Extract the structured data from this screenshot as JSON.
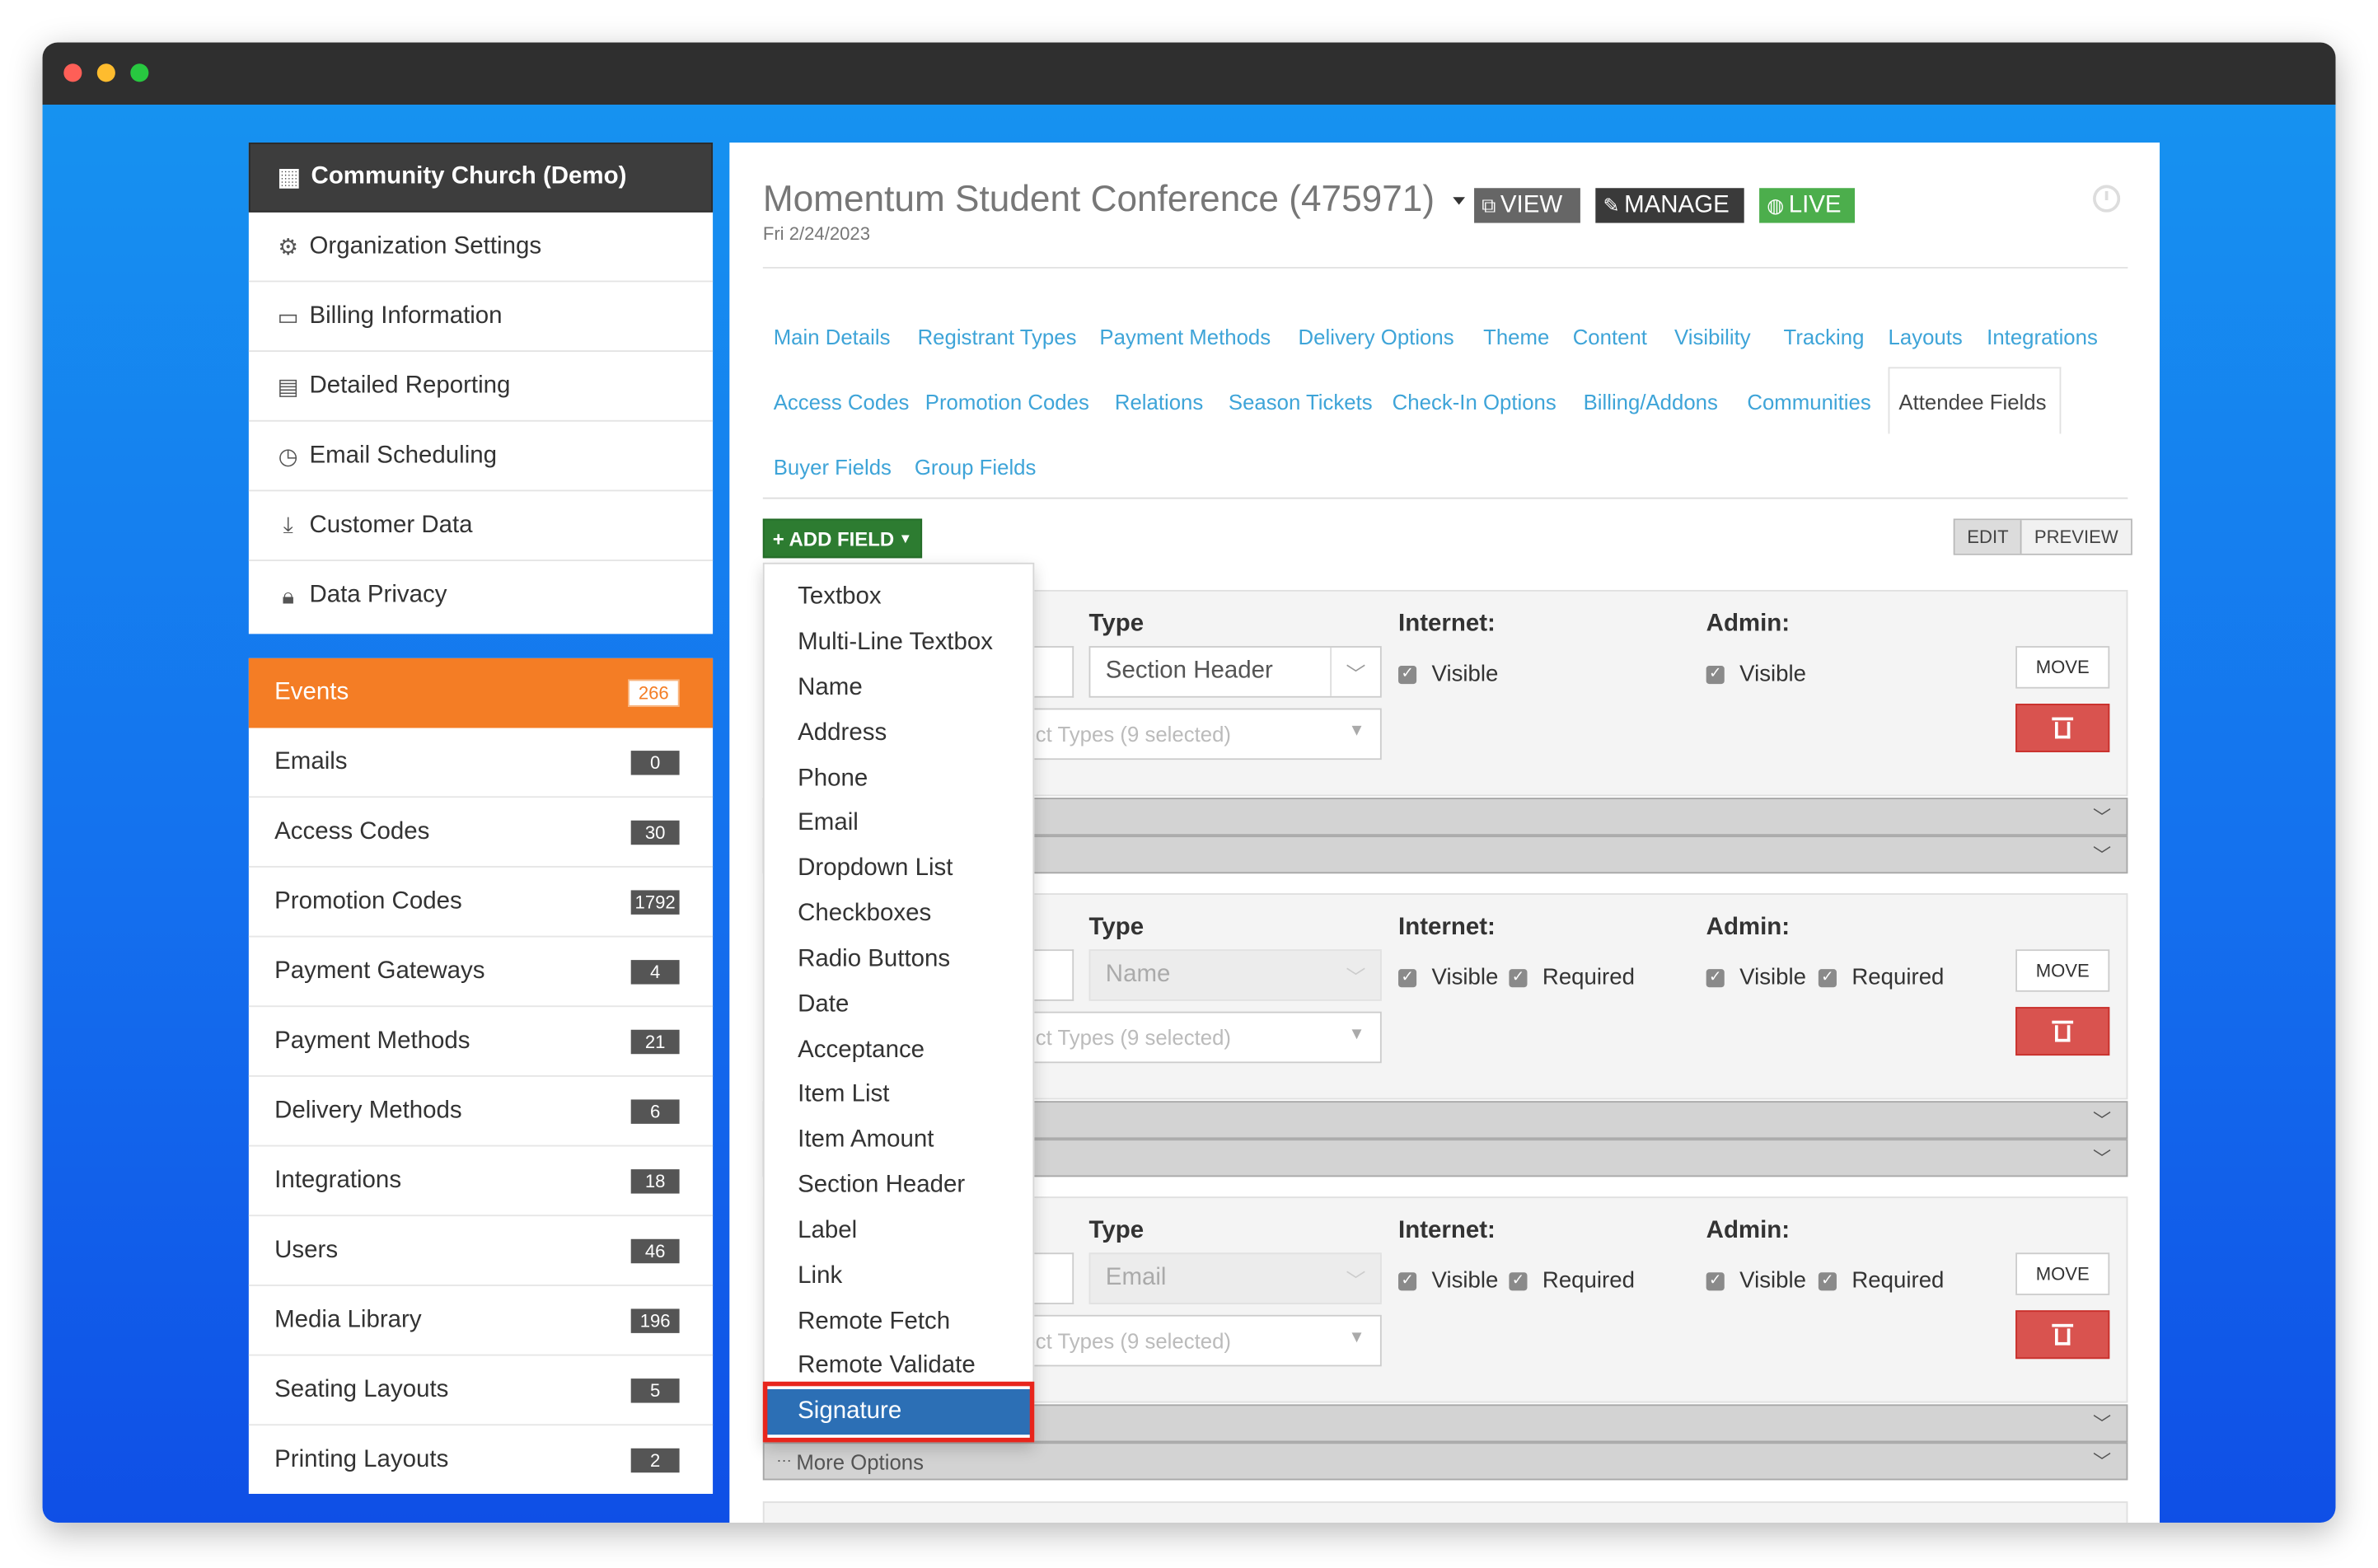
{
  "sidebar_top": {
    "org_name": "Community Church (Demo)",
    "items": [
      {
        "label": "Organization Settings",
        "icon": "gear-icon"
      },
      {
        "label": "Billing Information",
        "icon": "money-icon"
      },
      {
        "label": "Detailed Reporting",
        "icon": "document-icon"
      },
      {
        "label": "Email Scheduling",
        "icon": "clock-icon"
      },
      {
        "label": "Customer Data",
        "icon": "download-icon"
      },
      {
        "label": "Data Privacy",
        "icon": "lock-icon"
      }
    ]
  },
  "sidebar_nav": [
    {
      "label": "Events",
      "count": "266",
      "active": true
    },
    {
      "label": "Emails",
      "count": "0"
    },
    {
      "label": "Access Codes",
      "count": "30"
    },
    {
      "label": "Promotion Codes",
      "count": "1792"
    },
    {
      "label": "Payment Gateways",
      "count": "4"
    },
    {
      "label": "Payment Methods",
      "count": "21"
    },
    {
      "label": "Delivery Methods",
      "count": "6"
    },
    {
      "label": "Integrations",
      "count": "18"
    },
    {
      "label": "Users",
      "count": "46"
    },
    {
      "label": "Media Library",
      "count": "196"
    },
    {
      "label": "Seating Layouts",
      "count": "5"
    },
    {
      "label": "Printing Layouts",
      "count": "2"
    }
  ],
  "event": {
    "title": "Momentum Student Conference (475971)",
    "date": "Fri 2/24/2023",
    "view_label": "VIEW",
    "manage_label": "MANAGE",
    "live_label": "LIVE"
  },
  "tabs": [
    "Main Details",
    "Registrant Types",
    "Payment Methods",
    "Delivery Options",
    "Theme",
    "Content",
    "Visibility",
    "Tracking",
    "Layouts",
    "Integrations",
    "Access Codes",
    "Promotion Codes",
    "Relations",
    "Season Tickets",
    "Check-In Options",
    "Billing/Addons",
    "Communities",
    "Attendee Fields",
    "Buyer Fields",
    "Group Fields"
  ],
  "active_tab": "Attendee Fields",
  "toolbar": {
    "add_field_label": "+ ADD FIELD",
    "edit_label": "EDIT",
    "preview_label": "PREVIEW"
  },
  "field_labels": {
    "type": "Type",
    "internet": "Internet:",
    "admin": "Admin:",
    "visible": "Visible",
    "required": "Required",
    "move": "MOVE"
  },
  "fields": [
    {
      "type_value": "Section Header",
      "registrant_types": "ect Types (9 selected)"
    },
    {
      "type_value": "Name",
      "registrant_types": "ect Types (9 selected)"
    },
    {
      "type_value": "Email",
      "registrant_types": "ect Types (9 selected)"
    }
  ],
  "more_options_label": "More Options",
  "add_field_menu": {
    "items": [
      "Textbox",
      "Multi-Line Textbox",
      "Name",
      "Address",
      "Phone",
      "Email",
      "Dropdown List",
      "Checkboxes",
      "Radio Buttons",
      "Date",
      "Acceptance",
      "Item List",
      "Item Amount",
      "Section Header",
      "Label",
      "Link",
      "Remote Fetch",
      "Remote Validate",
      "Signature"
    ],
    "highlighted": "Signature"
  },
  "colors": {
    "events_active": "#f47d25",
    "tab_link": "#3ea4d8",
    "add_field": "#2d7c31",
    "delete": "#d9534f",
    "live": "#4cae4c",
    "highlight_outline": "#e8251c"
  }
}
